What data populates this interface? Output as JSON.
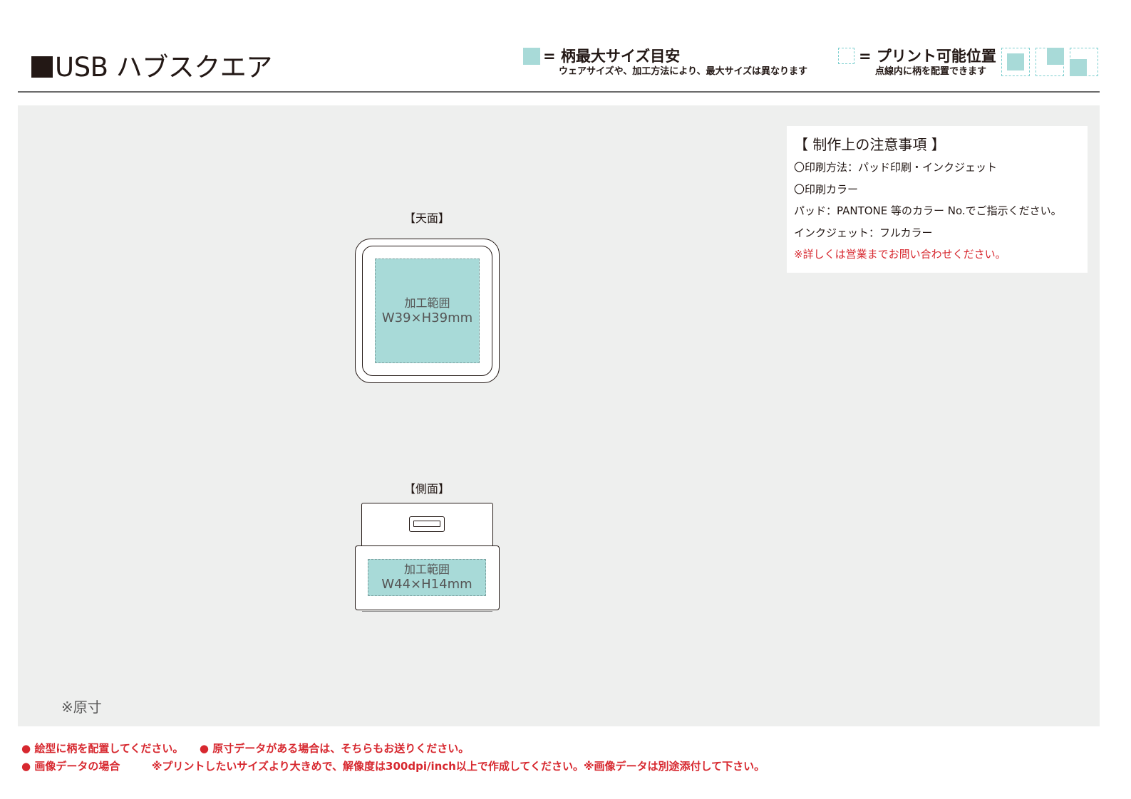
{
  "header": {
    "title": "USB ハブスクエア",
    "legend_max": {
      "label": "= 柄最大サイズ目安",
      "note": "ウェアサイズや、加工方法により、最大サイズは異なります",
      "color": "#a8dad8"
    },
    "legend_print": {
      "label": "= プリント可能位置",
      "note": "点線内に柄を配置できます",
      "color": "#7ccfcf"
    }
  },
  "notes": {
    "title": "【 制作上の注意事項 】",
    "lines": [
      "〇印刷方法：パッド印刷・インクジェット",
      "〇印刷カラー",
      "パッド：PANTONE 等のカラー No.でご指示ください。",
      "インクジェット：フルカラー"
    ],
    "warning": "※詳しくは営業までお問い合わせください。",
    "warning_color": "#d7282f"
  },
  "views": {
    "top": {
      "label": "【天面】",
      "area_label": "加工範囲",
      "area_size": "W39×H39mm"
    },
    "side": {
      "label": "【側面】",
      "area_label": "加工範囲",
      "area_size": "W44×H14mm"
    }
  },
  "actual_size_note": "※原寸",
  "footer": {
    "bullet": "●",
    "line1_a": "絵型に柄を配置してください。",
    "line1_b": "原寸データがある場合は、そちらもお送りください。",
    "line2_a": "画像データの場合",
    "line2_b": "※プリントしたいサイズより大きめで、解像度は300dpi/inch以上で作成してください。※画像データは別途添付して下さい。"
  }
}
